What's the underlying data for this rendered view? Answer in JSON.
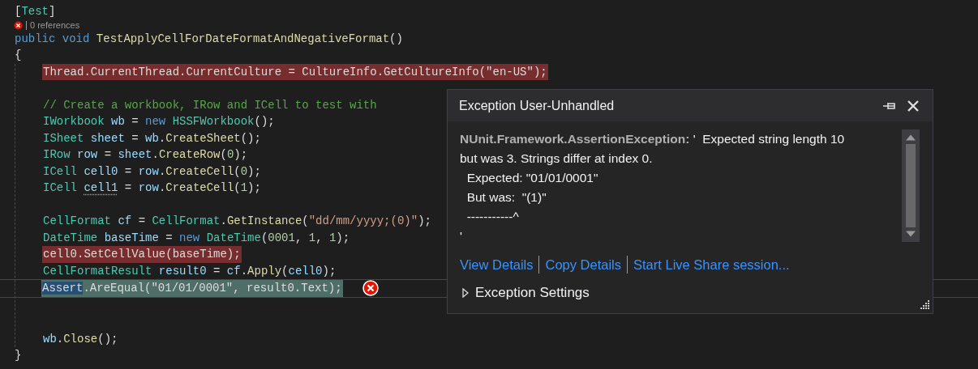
{
  "editor": {
    "lines": [
      {
        "kind": "code",
        "tokens": [
          {
            "text": "[",
            "kind": "plain"
          },
          {
            "text": "Test",
            "kind": "type"
          },
          {
            "text": "]",
            "kind": "plain"
          }
        ]
      },
      {
        "kind": "lens",
        "error": true,
        "text": "0 references"
      },
      {
        "kind": "code",
        "tokens": [
          {
            "text": "public void ",
            "kind": "keyword"
          },
          {
            "text": "TestApplyCellForDateFormatAndNegativeFormat",
            "kind": "method"
          },
          {
            "text": "()",
            "kind": "plain"
          }
        ]
      },
      {
        "kind": "code",
        "tokens": [
          {
            "text": "{",
            "kind": "plain"
          }
        ]
      },
      {
        "kind": "block",
        "children": [
          {
            "kind": "code",
            "error_highlight": true,
            "tokens": [
              {
                "text": "Thread.CurrentThread.CurrentCulture = CultureInfo.GetCultureInfo(\"en-US\");",
                "kind": "plain"
              }
            ]
          },
          {
            "kind": "blank"
          },
          {
            "kind": "code",
            "tokens": [
              {
                "text": "// Create a workbook, IRow and ICell to test with",
                "kind": "comment"
              }
            ]
          },
          {
            "kind": "code",
            "tokens": [
              {
                "text": "IWorkbook ",
                "kind": "type"
              },
              {
                "text": "wb",
                "kind": "variable"
              },
              {
                "text": " = ",
                "kind": "plain"
              },
              {
                "text": "new ",
                "kind": "keyword"
              },
              {
                "text": "HSSFWorkbook",
                "kind": "type"
              },
              {
                "text": "();",
                "kind": "plain"
              }
            ]
          },
          {
            "kind": "code",
            "tokens": [
              {
                "text": "ISheet ",
                "kind": "type"
              },
              {
                "text": "sheet",
                "kind": "variable"
              },
              {
                "text": " = ",
                "kind": "plain"
              },
              {
                "text": "wb",
                "kind": "variable"
              },
              {
                "text": ".",
                "kind": "plain"
              },
              {
                "text": "CreateSheet",
                "kind": "method"
              },
              {
                "text": "();",
                "kind": "plain"
              }
            ]
          },
          {
            "kind": "code",
            "tokens": [
              {
                "text": "IRow ",
                "kind": "type"
              },
              {
                "text": "row",
                "kind": "variable"
              },
              {
                "text": " = ",
                "kind": "plain"
              },
              {
                "text": "sheet",
                "kind": "variable"
              },
              {
                "text": ".",
                "kind": "plain"
              },
              {
                "text": "CreateRow",
                "kind": "method"
              },
              {
                "text": "(",
                "kind": "plain"
              },
              {
                "text": "0",
                "kind": "number"
              },
              {
                "text": ");",
                "kind": "plain"
              }
            ]
          },
          {
            "kind": "code",
            "tokens": [
              {
                "text": "ICell ",
                "kind": "type"
              },
              {
                "text": "cell0",
                "kind": "variable"
              },
              {
                "text": " = ",
                "kind": "plain"
              },
              {
                "text": "row",
                "kind": "variable"
              },
              {
                "text": ".",
                "kind": "plain"
              },
              {
                "text": "CreateCell",
                "kind": "method"
              },
              {
                "text": "(",
                "kind": "plain"
              },
              {
                "text": "0",
                "kind": "number"
              },
              {
                "text": ");",
                "kind": "plain"
              }
            ]
          },
          {
            "kind": "code",
            "tokens": [
              {
                "text": "ICell ",
                "kind": "type"
              },
              {
                "text": "cell1",
                "kind": "variable",
                "suggestion": true
              },
              {
                "text": " = ",
                "kind": "plain"
              },
              {
                "text": "row",
                "kind": "variable"
              },
              {
                "text": ".",
                "kind": "plain"
              },
              {
                "text": "CreateCell",
                "kind": "method"
              },
              {
                "text": "(",
                "kind": "plain"
              },
              {
                "text": "1",
                "kind": "number"
              },
              {
                "text": ");",
                "kind": "plain"
              }
            ]
          },
          {
            "kind": "blank"
          },
          {
            "kind": "code",
            "tokens": [
              {
                "text": "CellFormat ",
                "kind": "type"
              },
              {
                "text": "cf",
                "kind": "variable"
              },
              {
                "text": " = ",
                "kind": "plain"
              },
              {
                "text": "CellFormat",
                "kind": "type"
              },
              {
                "text": ".",
                "kind": "plain"
              },
              {
                "text": "GetInstance",
                "kind": "method"
              },
              {
                "text": "(",
                "kind": "plain"
              },
              {
                "text": "\"dd/mm/yyyy;(0)\"",
                "kind": "string"
              },
              {
                "text": ");",
                "kind": "plain"
              }
            ]
          },
          {
            "kind": "code",
            "tokens": [
              {
                "text": "DateTime ",
                "kind": "type"
              },
              {
                "text": "baseTime",
                "kind": "variable"
              },
              {
                "text": " = ",
                "kind": "plain"
              },
              {
                "text": "new ",
                "kind": "keyword"
              },
              {
                "text": "DateTime",
                "kind": "type"
              },
              {
                "text": "(",
                "kind": "plain"
              },
              {
                "text": "0001",
                "kind": "number"
              },
              {
                "text": ", ",
                "kind": "plain"
              },
              {
                "text": "1",
                "kind": "number"
              },
              {
                "text": ", ",
                "kind": "plain"
              },
              {
                "text": "1",
                "kind": "number"
              },
              {
                "text": ");",
                "kind": "plain"
              }
            ]
          },
          {
            "kind": "code",
            "error_highlight": true,
            "tokens": [
              {
                "text": "cell0.SetCellValue(baseTime);",
                "kind": "plain"
              }
            ]
          },
          {
            "kind": "code",
            "tokens": [
              {
                "text": "CellFormatResult ",
                "kind": "type"
              },
              {
                "text": "result0",
                "kind": "variable"
              },
              {
                "text": " = ",
                "kind": "plain"
              },
              {
                "text": "cf",
                "kind": "variable"
              },
              {
                "text": ".",
                "kind": "plain"
              },
              {
                "text": "Apply",
                "kind": "method"
              },
              {
                "text": "(",
                "kind": "plain"
              },
              {
                "text": "cell0",
                "kind": "variable"
              },
              {
                "text": ");",
                "kind": "plain"
              }
            ]
          },
          {
            "kind": "code",
            "current": true,
            "error": true,
            "tokens": [
              {
                "text": "Assert",
                "kind": "plain",
                "selected": true
              },
              {
                "text": ".AreEqual(\"01/01/0001\", result0.Text);",
                "kind": "plain",
                "selected": false
              }
            ]
          },
          {
            "kind": "blank"
          },
          {
            "kind": "blank"
          },
          {
            "kind": "code",
            "tokens": [
              {
                "text": "wb",
                "kind": "variable"
              },
              {
                "text": ".",
                "kind": "plain"
              },
              {
                "text": "Close",
                "kind": "method"
              },
              {
                "text": "();",
                "kind": "plain"
              }
            ]
          }
        ]
      },
      {
        "kind": "code",
        "tokens": [
          {
            "text": "}",
            "kind": "plain"
          }
        ]
      }
    ]
  },
  "popup": {
    "title": "Exception User-Unhandled",
    "message": [
      "**NUnit.Framework.AssertionException:** '  Expected string length 10 but was 3. Strings differ at index 0.",
      "  Expected: \"01/01/0001\"",
      "  But was:  \"(1)\"",
      "  -----------^",
      "'"
    ],
    "links": [
      "View Details",
      "Copy Details",
      "Start Live Share session..."
    ],
    "settings": {
      "label": "Exception Settings",
      "expanded": false
    }
  }
}
